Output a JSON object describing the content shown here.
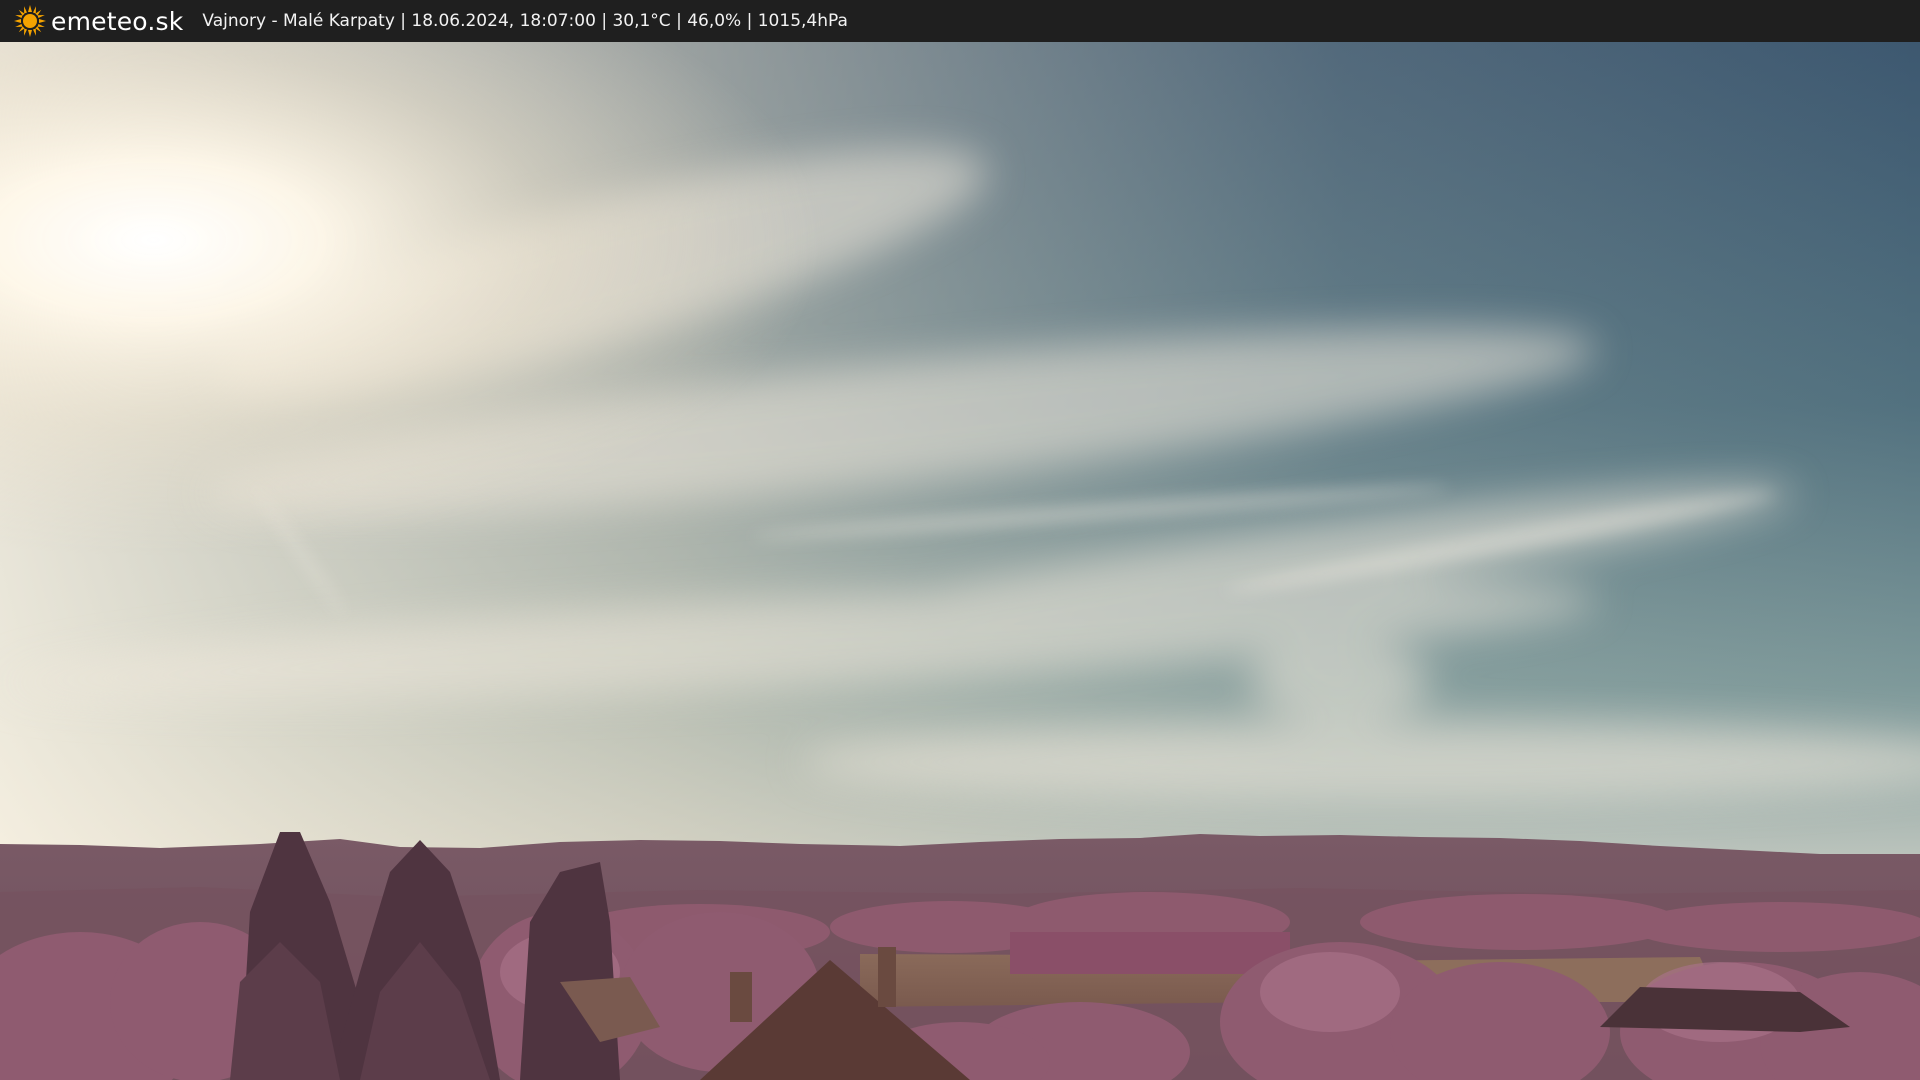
{
  "header": {
    "logo_text": "emeteo.sk",
    "caption": "Vajnory - Malé Karpaty | 18.06.2024, 18:07:00 | 30,1°C | 46,0% | 1015,4hPa"
  },
  "icons": {
    "logo": "sun-icon"
  },
  "colors": {
    "bar_background": "#1f1f1f",
    "sun_icon": "#f5a300",
    "sky_top": "#3b5a73",
    "sky_horizon": "#dcd7c8",
    "foliage": "#8e5a6e"
  }
}
